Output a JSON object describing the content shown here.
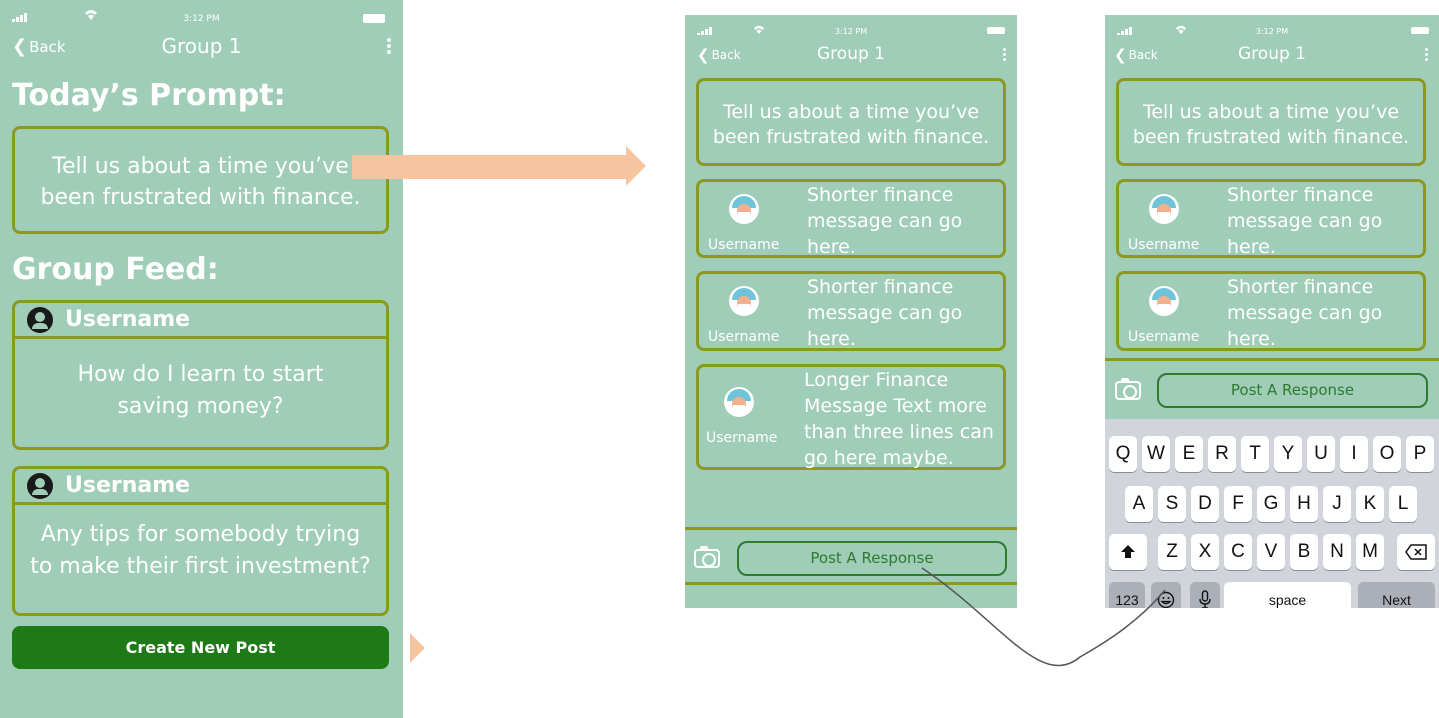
{
  "status": {
    "time": "3:12 PM"
  },
  "nav": {
    "back_label": "Back",
    "title": "Group 1"
  },
  "screen1": {
    "prompt_heading": "Today’s Prompt:",
    "prompt_line1": "Tell us about a time you’ve",
    "prompt_line2": "been frustrated with finance.",
    "feed_heading": "Group Feed:",
    "posts": [
      {
        "username": "Username",
        "line1": "How do I learn to start",
        "line2": "saving money?"
      },
      {
        "username": "Username",
        "line1": "Any tips for somebody trying",
        "line2": "to make their first investment?"
      }
    ],
    "create_button": "Create New Post"
  },
  "chat": {
    "prompt_line1": "Tell us about a time you’ve",
    "prompt_line2": "been frustrated with finance.",
    "messages": [
      {
        "username": "Username",
        "lines": [
          "Shorter finance",
          "message can go",
          "here."
        ]
      },
      {
        "username": "Username",
        "lines": [
          "Shorter finance",
          "message can go",
          "here."
        ]
      },
      {
        "username": "Username",
        "lines": [
          "Longer Finance",
          "Message Text more",
          "than three lines can",
          "go here maybe."
        ]
      }
    ],
    "post_button": "Post A Response"
  },
  "keyboard": {
    "row1": [
      "Q",
      "W",
      "E",
      "R",
      "T",
      "Y",
      "U",
      "I",
      "O",
      "P"
    ],
    "row2": [
      "A",
      "S",
      "D",
      "F",
      "G",
      "H",
      "J",
      "K",
      "L"
    ],
    "row3": [
      "Z",
      "X",
      "C",
      "V",
      "B",
      "N",
      "M"
    ],
    "numbers_key": "123",
    "space_key": "space",
    "next_key": "Next"
  },
  "colors": {
    "screen_bg": "#9fcdb8",
    "border": "#8a9a1e",
    "button_green": "#1e7a16",
    "arrow": "#f7c4a0"
  },
  "icons": [
    "signal-icon",
    "wifi-icon",
    "battery-icon",
    "chevron-left-icon",
    "kebab-menu-icon",
    "user-icon",
    "avatar-icon",
    "camera-icon",
    "shift-icon",
    "backspace-icon",
    "emoji-icon",
    "microphone-icon"
  ]
}
